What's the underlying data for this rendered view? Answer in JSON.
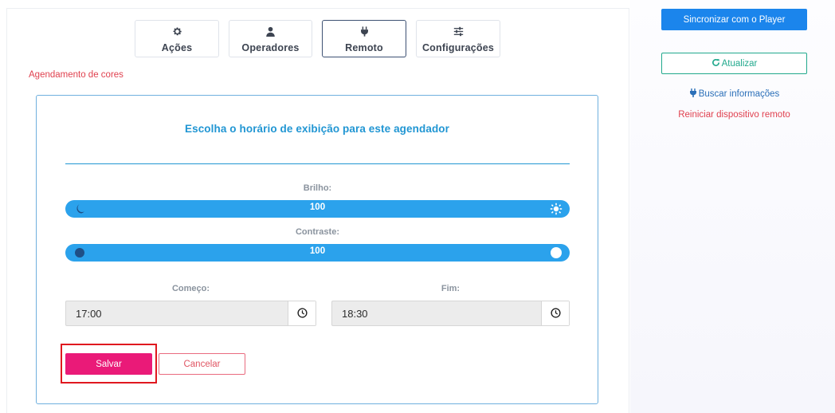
{
  "tabs": [
    {
      "label": "Ações",
      "icon": "gear-icon"
    },
    {
      "label": "Operadores",
      "icon": "user-icon"
    },
    {
      "label": "Remoto",
      "icon": "plug-icon"
    },
    {
      "label": "Configurações",
      "icon": "sliders-icon"
    }
  ],
  "active_tab": "Remoto",
  "section_title": "Agendamento de cores",
  "card": {
    "title": "Escolha o horário de exibição para este agendador",
    "brightness": {
      "label": "Brilho:",
      "value": "100",
      "left_icon": "moon-icon",
      "right_icon": "sun-icon"
    },
    "contrast": {
      "label": "Contraste:",
      "value": "100",
      "left_icon": "dark-circle-icon",
      "right_icon": "light-circle-icon"
    },
    "start": {
      "label": "Começo:",
      "value": "17:00",
      "icon": "clock-icon"
    },
    "end": {
      "label": "Fim:",
      "value": "18:30",
      "icon": "clock-icon"
    },
    "save_label": "Salvar",
    "cancel_label": "Cancelar"
  },
  "sidebar": {
    "sync_label": "Sincronizar com o Player",
    "refresh_label": "Atualizar",
    "info_label": "Buscar informações",
    "restart_label": "Reiniciar dispositivo remoto"
  },
  "colors": {
    "accent_blue": "#2196d3",
    "slider_blue": "#2ba2ec",
    "save_pink": "#ea1a78",
    "danger_red": "#e0414f",
    "refresh_green": "#22a98d",
    "sync_blue": "#1b85ec"
  }
}
